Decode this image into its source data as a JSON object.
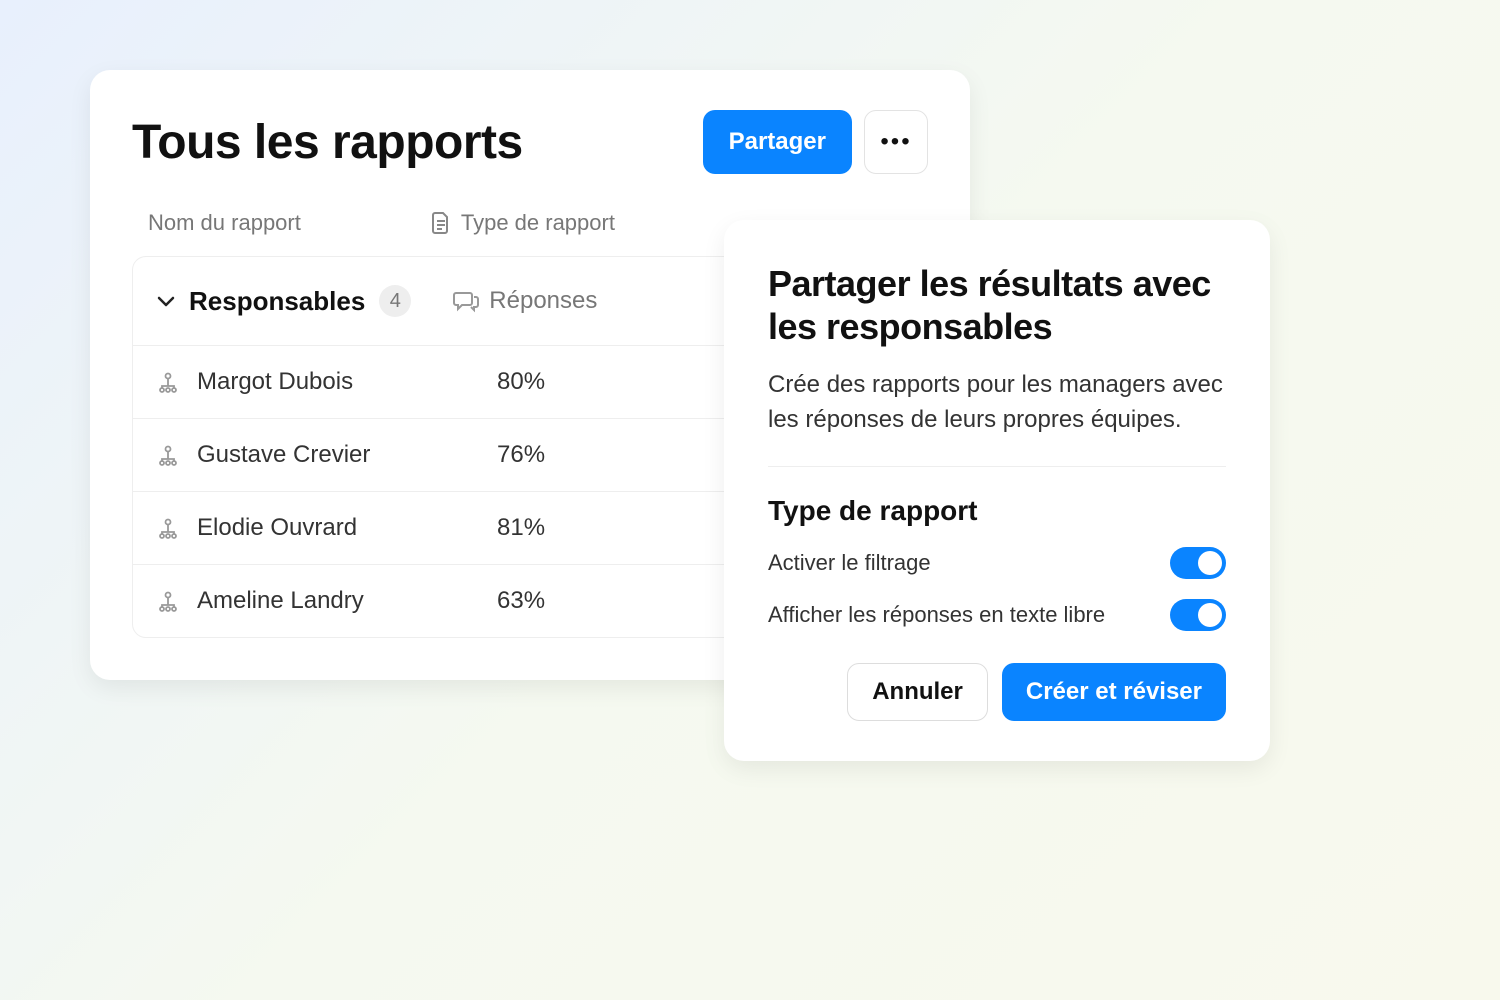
{
  "colors": {
    "primary": "#0a84ff"
  },
  "page": {
    "title": "Tous les rapports",
    "share_label": "Partager",
    "columns": {
      "name": "Nom du rapport",
      "type": "Type de rapport"
    }
  },
  "group": {
    "label": "Responsables",
    "count": "4",
    "responses_label": "Réponses"
  },
  "rows": [
    {
      "name": "Margot Dubois",
      "value": "80%"
    },
    {
      "name": "Gustave Crevier",
      "value": "76%"
    },
    {
      "name": "Elodie Ouvrard",
      "value": "81%"
    },
    {
      "name": "Ameline Landry",
      "value": "63%"
    }
  ],
  "dialog": {
    "title": "Partager les résultats avec les responsables",
    "description": "Crée des rapports pour les managers avec les réponses de leurs propres équipes.",
    "section_label": "Type de rapport",
    "toggles": {
      "filtering": "Activer le filtrage",
      "free_text": "Afficher les réponses en texte libre"
    },
    "cancel_label": "Annuler",
    "submit_label": "Créer et réviser"
  }
}
